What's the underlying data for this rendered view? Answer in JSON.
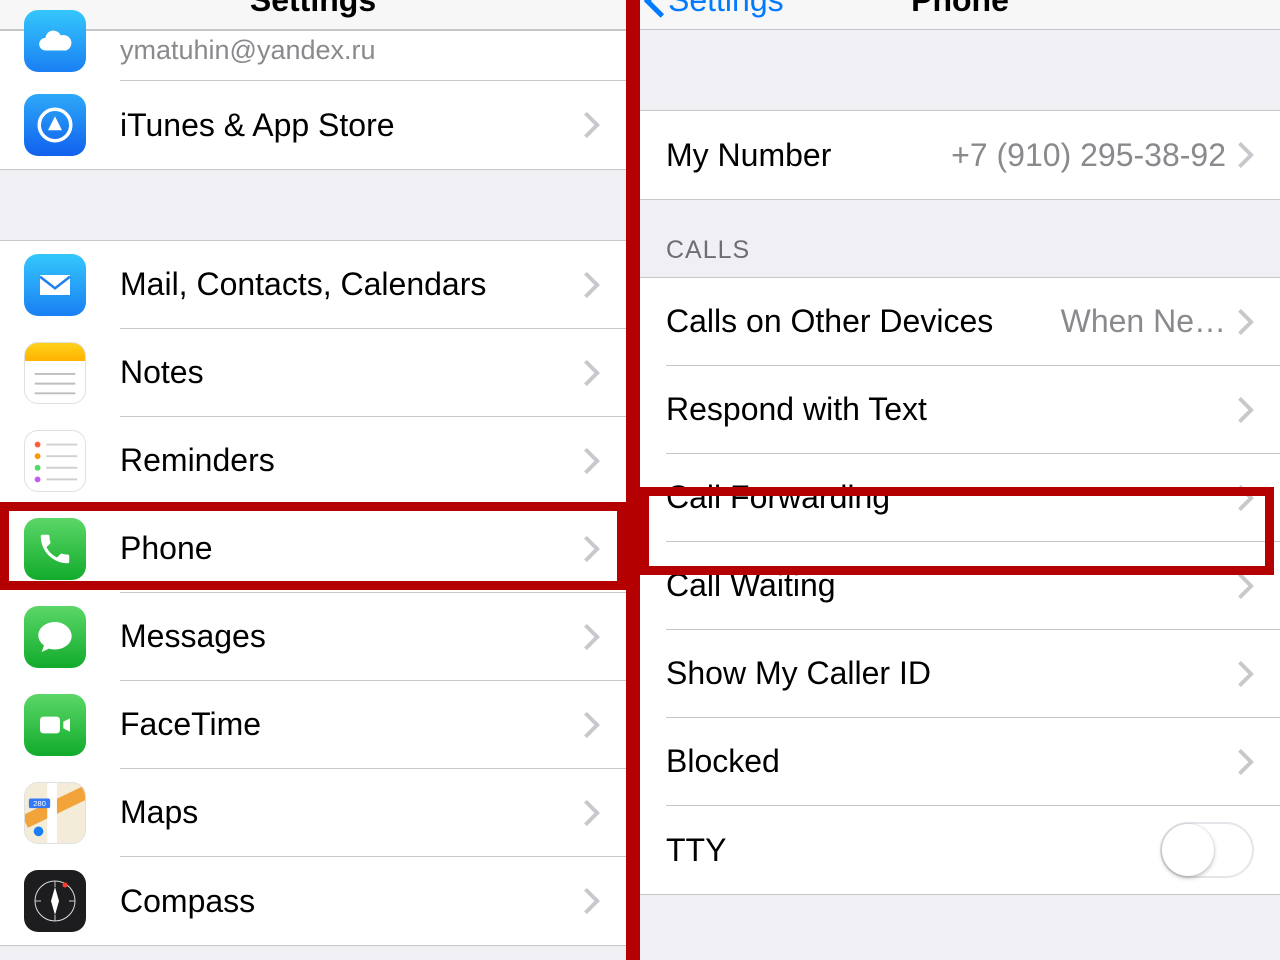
{
  "left": {
    "title": "Settings",
    "email": "ymatuhin@yandex.ru",
    "items": {
      "appstore": "iTunes & App Store",
      "mail": "Mail, Contacts, Calendars",
      "notes": "Notes",
      "reminders": "Reminders",
      "phone": "Phone",
      "messages": "Messages",
      "facetime": "FaceTime",
      "maps": "Maps",
      "compass": "Compass"
    }
  },
  "right": {
    "back": "Settings",
    "title": "Phone",
    "my_number_label": "My Number",
    "my_number_value": "+7 (910) 295-38-92",
    "calls_header": "CALLS",
    "calls": {
      "other_devices": "Calls on Other Devices",
      "other_devices_detail": "When Ne…",
      "respond": "Respond with Text",
      "forwarding": "Call Forwarding",
      "waiting": "Call Waiting",
      "callerid": "Show My Caller ID",
      "blocked": "Blocked",
      "tty": "TTY"
    }
  }
}
